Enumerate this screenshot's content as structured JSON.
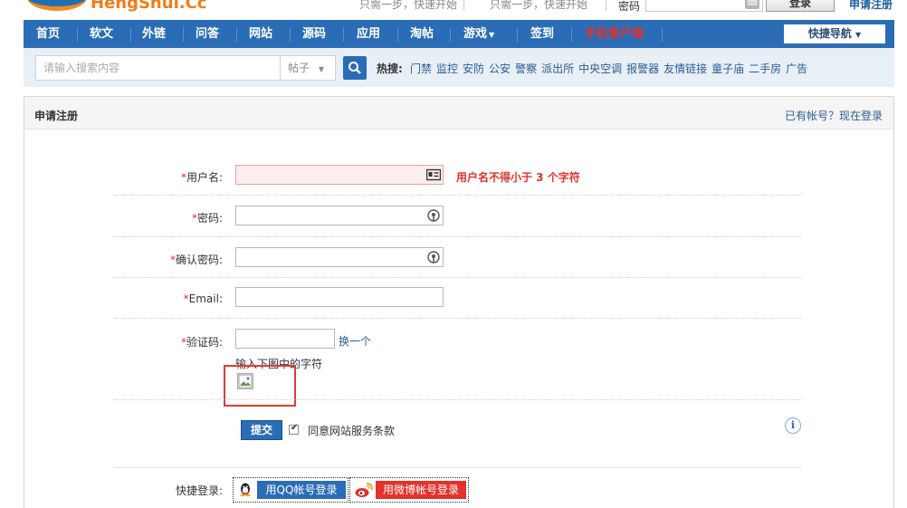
{
  "site": {
    "logo_text": "HengShui.Cc",
    "tagline_1": "只需一步，快速开始",
    "tagline_2": "只需一步，快速开始",
    "password_label": "密码",
    "login_button": "登录",
    "register_link": "申请注册"
  },
  "nav": {
    "items": [
      "首页",
      "软文",
      "外链",
      "问答",
      "网站",
      "源码",
      "应用",
      "淘帖",
      "游戏",
      "签到",
      "手机客户端"
    ],
    "quick_nav": "快捷导航",
    "mobile_color": "#e4312b"
  },
  "search": {
    "placeholder": "请输入搜索内容",
    "type": "帖子",
    "hot_label": "热搜:",
    "hot_items": [
      "门禁",
      "监控",
      "安防",
      "公安",
      "警察",
      "派出所",
      "中央空调",
      "报警器",
      "友情链接",
      "童子庙",
      "二手房",
      "广告"
    ]
  },
  "panel": {
    "title": "申请注册",
    "login_prompt": "已有帐号？现在登录"
  },
  "form": {
    "username_label": "用户名:",
    "username_error": "用户名不得小于 3 个字符",
    "password_label": "密码:",
    "confirm_label": "确认密码:",
    "email_label": "Email:",
    "captcha_label": "验证码:",
    "captcha_refresh": "换一个",
    "captcha_hint": "输入下图中的字符",
    "required_mark": "*",
    "submit": "提交",
    "agree_text": "同意网站服务条款",
    "quick_login_label": "快捷登录:",
    "qq_login": "用QQ帐号登录",
    "weibo_login": "用微博帐号登录"
  },
  "colors": {
    "nav_bg": "#2b6cb6",
    "error": "#e4312b",
    "search_bg": "#e8eff7"
  }
}
